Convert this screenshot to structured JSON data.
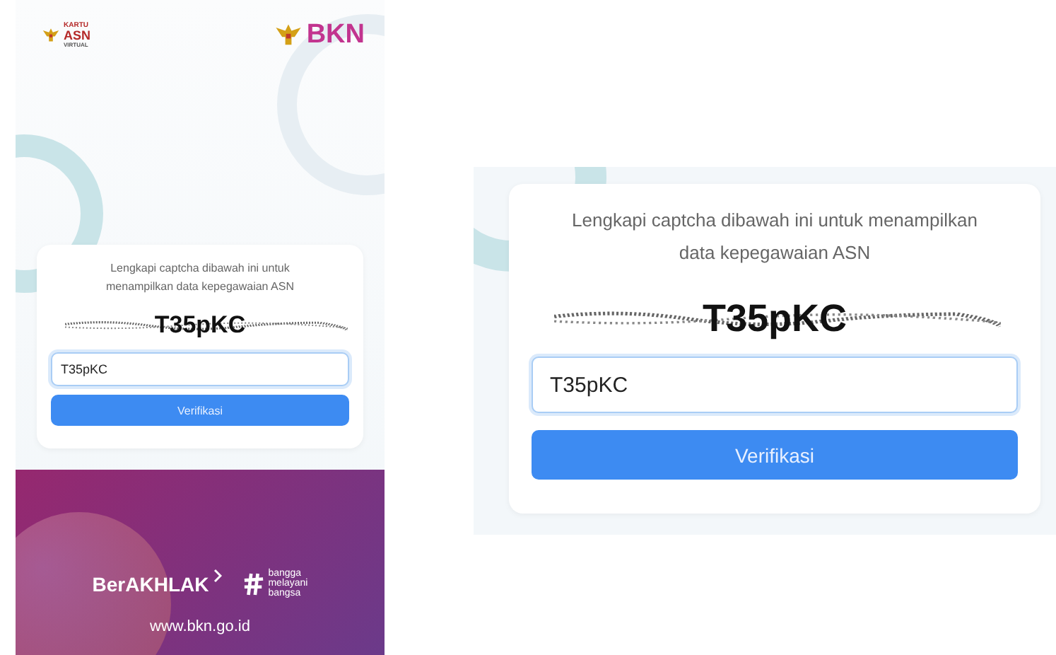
{
  "phone": {
    "header": {
      "app_logo": [
        "KARTU",
        "ASN",
        "VIRTUAL"
      ],
      "brand": "BKN"
    },
    "card": {
      "instruction": "Lengkapi captcha dibawah ini untuk menampilkan data kepegawaian ASN",
      "captcha": "T35pKC",
      "input": {
        "value": "T35pKC",
        "focused": true
      },
      "button": "Verifikasi"
    },
    "footer": {
      "slogan": "BerAKHLAK",
      "tagline": [
        "bangga",
        "melayani",
        "bangsa"
      ],
      "website": "www.bkn.go.id"
    }
  },
  "zoom_view": {
    "card": {
      "instruction": "Lengkapi captcha dibawah ini untuk menampilkan data kepegawaian ASN",
      "captcha": "T35pKC",
      "input": {
        "value": "T35pKC",
        "focused": true
      },
      "button": "Verifikasi"
    }
  }
}
